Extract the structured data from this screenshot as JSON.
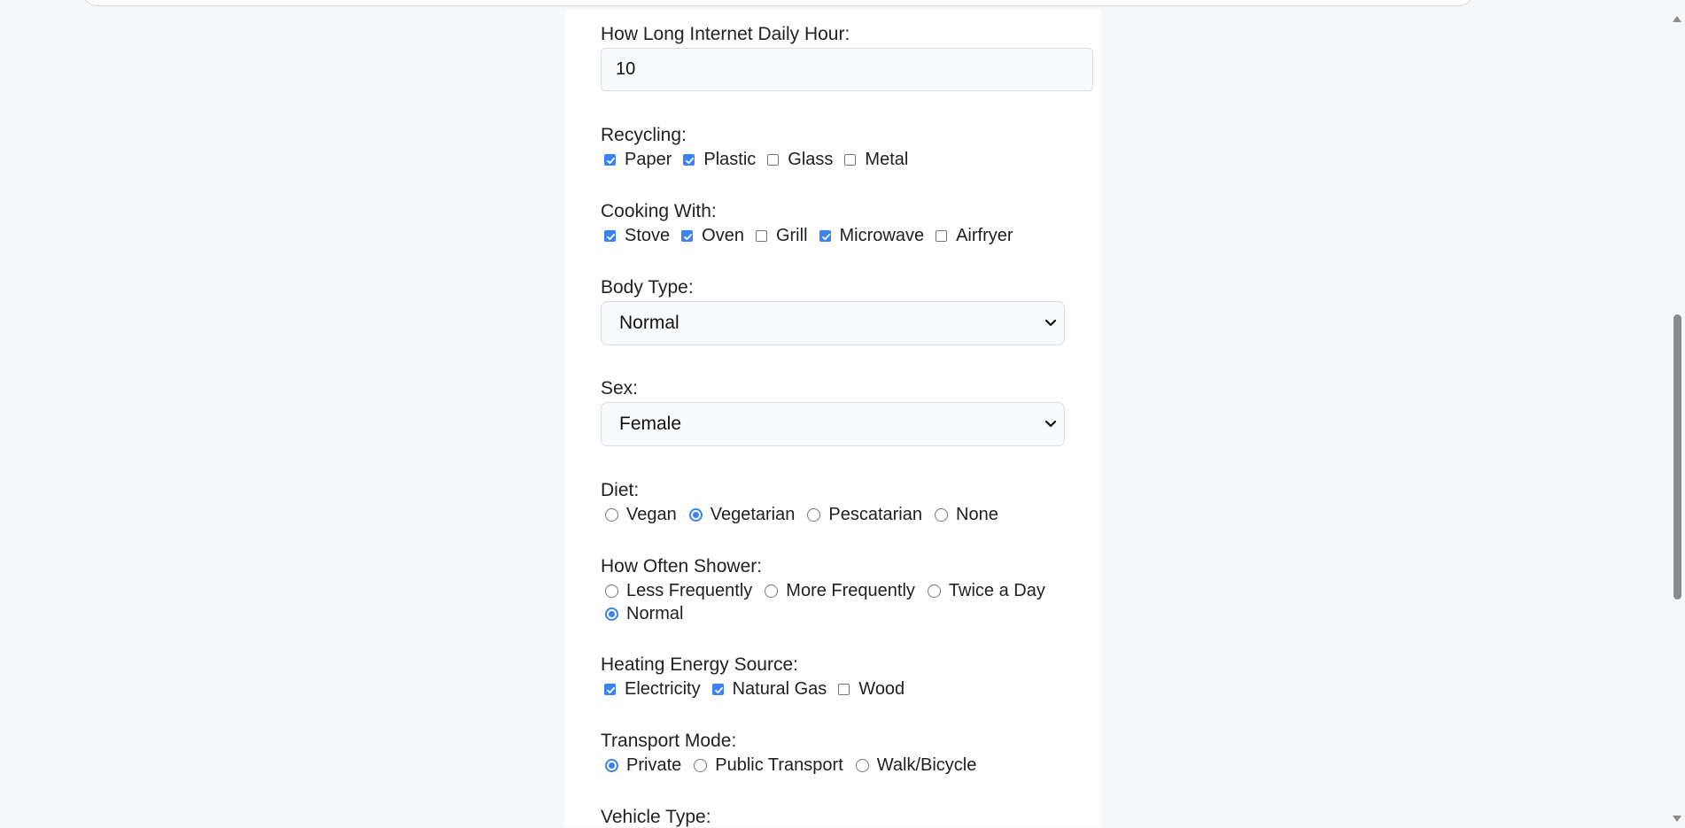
{
  "internet": {
    "label": "How Long Internet Daily Hour:",
    "value": "10"
  },
  "recycling": {
    "label": "Recycling:",
    "options": [
      {
        "label": "Paper",
        "checked": true
      },
      {
        "label": "Plastic",
        "checked": true
      },
      {
        "label": "Glass",
        "checked": false
      },
      {
        "label": "Metal",
        "checked": false
      }
    ]
  },
  "cooking": {
    "label": "Cooking With:",
    "options": [
      {
        "label": "Stove",
        "checked": true
      },
      {
        "label": "Oven",
        "checked": true
      },
      {
        "label": "Grill",
        "checked": false
      },
      {
        "label": "Microwave",
        "checked": true
      },
      {
        "label": "Airfryer",
        "checked": false
      }
    ]
  },
  "body_type": {
    "label": "Body Type:",
    "selected": "Normal"
  },
  "sex": {
    "label": "Sex:",
    "selected": "Female"
  },
  "diet": {
    "label": "Diet:",
    "options": [
      {
        "label": "Vegan",
        "checked": false
      },
      {
        "label": "Vegetarian",
        "checked": true
      },
      {
        "label": "Pescatarian",
        "checked": false
      },
      {
        "label": "None",
        "checked": false
      }
    ]
  },
  "shower": {
    "label": "How Often Shower:",
    "options": [
      {
        "label": "Less Frequently",
        "checked": false
      },
      {
        "label": "More Frequently",
        "checked": false
      },
      {
        "label": "Twice a Day",
        "checked": false
      },
      {
        "label": "Normal",
        "checked": true
      }
    ]
  },
  "heating": {
    "label": "Heating Energy Source:",
    "options": [
      {
        "label": "Electricity",
        "checked": true
      },
      {
        "label": "Natural Gas",
        "checked": true
      },
      {
        "label": "Wood",
        "checked": false
      }
    ]
  },
  "transport": {
    "label": "Transport Mode:",
    "options": [
      {
        "label": "Private",
        "checked": true
      },
      {
        "label": "Public Transport",
        "checked": false
      },
      {
        "label": "Walk/Bicycle",
        "checked": false
      }
    ]
  },
  "vehicle": {
    "label": "Vehicle Type:"
  },
  "colors": {
    "accent": "#3b82f6",
    "page_bg": "#f6f7f9",
    "card_bg": "#ffffff"
  }
}
